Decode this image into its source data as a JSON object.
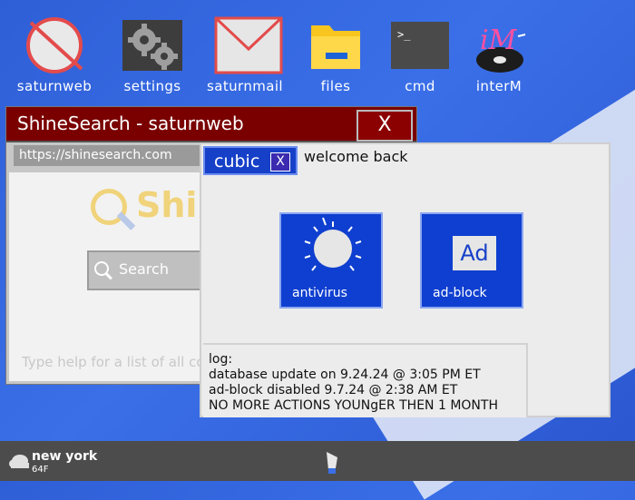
{
  "desktop": {
    "icons": [
      {
        "label": "saturnweb",
        "icon": "no-entry-browser-icon"
      },
      {
        "label": "settings",
        "icon": "gears-icon"
      },
      {
        "label": "saturnmail",
        "icon": "envelope-icon"
      },
      {
        "label": "files",
        "icon": "folder-icon"
      },
      {
        "label": "cmd",
        "icon": "terminal-icon"
      },
      {
        "label": "interM",
        "icon": "music-disc-icon"
      }
    ]
  },
  "browser": {
    "title": "ShineSearch - saturnweb",
    "close_label": "X",
    "address": "https://shinesearch.com",
    "logo_text": "ShineSearch",
    "search_placeholder": "Search",
    "help_text": "Type help for a list of all commands"
  },
  "panel": {
    "tab_label": "cubic",
    "tab_close": "X",
    "welcome": "welcome back",
    "tiles": [
      {
        "label": "antivirus",
        "icon": "sun-shield-icon"
      },
      {
        "label": "ad-block",
        "badge": "Ad"
      }
    ],
    "log": {
      "title": "log:",
      "lines": [
        "database update on 9.24.24 @ 3:05 PM ET",
        "ad-block disabled 9.7.24 @ 2:38 AM ET",
        "NO MORE ACTIONS YOUNgER THEN 1 MONTH"
      ]
    }
  },
  "taskbar": {
    "city": "new york",
    "temp": "64F"
  },
  "colors": {
    "accent_blue": "#1740c8",
    "titlebar_red": "#7a0000",
    "taskbar": "#4c4c4c"
  }
}
